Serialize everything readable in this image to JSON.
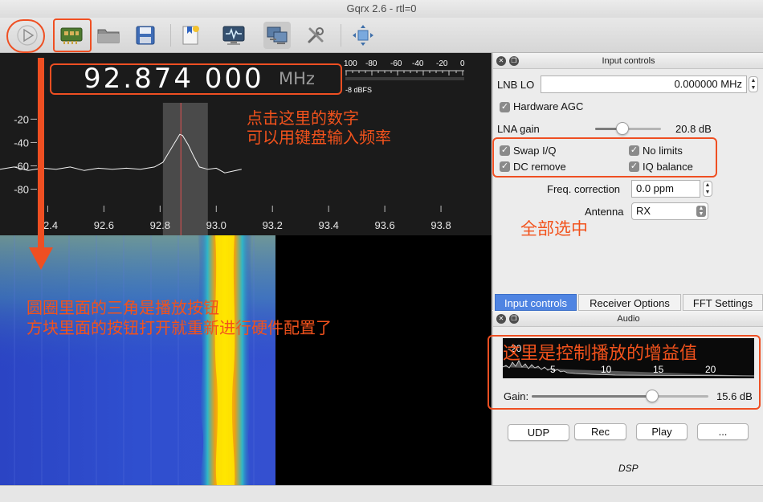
{
  "window": {
    "title": "Gqrx 2.6 - rtl=0"
  },
  "toolbar": {
    "items": [
      {
        "icon": "play-icon",
        "tip": "start-dsp"
      },
      {
        "icon": "hardware-config-icon",
        "tip": "configure-device"
      },
      {
        "icon": "folder-icon",
        "tip": "load-settings"
      },
      {
        "icon": "save-icon",
        "tip": "save-settings"
      },
      {
        "icon": "bookmark-icon",
        "tip": "bookmarks"
      },
      {
        "icon": "dsp-scope-icon",
        "tip": "iq-tool"
      },
      {
        "icon": "remote-control-icon",
        "tip": "remote-control"
      },
      {
        "icon": "tools-icon",
        "tip": "settings"
      },
      {
        "icon": "fullscreen-icon",
        "tip": "fullscreen"
      }
    ]
  },
  "frequency": {
    "digits": "92.874 000",
    "unit": "MHz"
  },
  "smeter": {
    "scale": [
      "100",
      "-80",
      "-60",
      "-40",
      "-20",
      "0"
    ],
    "unit": "-8 dBFS"
  },
  "chart_data": {
    "type": "line",
    "title": "",
    "xlabel": "",
    "ylabel": "",
    "x_ticks": [
      "92.4",
      "92.6",
      "92.8",
      "93.0",
      "93.2",
      "93.4",
      "93.6",
      "93.8"
    ],
    "y_ticks": [
      "-20",
      "-40",
      "-60",
      "-80"
    ],
    "xlim": [
      92.23,
      93.98
    ],
    "ylim": [
      -92,
      -6
    ],
    "series": [
      {
        "name": "",
        "x": [
          92.23,
          92.28,
          92.33,
          92.38,
          92.43,
          92.48,
          92.53,
          92.58,
          92.63,
          92.68,
          92.73,
          92.78,
          92.81,
          92.83,
          92.85,
          92.86,
          92.87,
          92.88,
          92.9,
          92.92,
          92.94,
          92.97,
          93.0,
          93.03,
          93.07,
          93.09
        ],
        "y": [
          -63,
          -61,
          -64,
          -62,
          -63,
          -61,
          -64,
          -62,
          -63,
          -62,
          -63,
          -61,
          -57,
          -49,
          -41,
          -37,
          -33,
          -34,
          -42,
          -52,
          -61,
          -63,
          -62,
          -66,
          -64,
          -63
        ]
      }
    ],
    "grid": false
  },
  "spectrum": {
    "filter_band": [
      92.81,
      92.97
    ],
    "center_mhz": 92.874
  },
  "input_controls": {
    "title": "Input controls",
    "lnb_label": "LNB LO",
    "lnb_value": "0.000000 MHz",
    "hw_agc": "Hardware AGC",
    "lna_label": "LNA gain",
    "lna_value": "20.8 dB",
    "lna_level": 0.42,
    "swap_iq": "Swap I/Q",
    "no_limits": "No limits",
    "dc_remove": "DC remove",
    "iq_balance": "IQ balance",
    "freq_corr_label": "Freq. correction",
    "freq_corr_value": "0.0 ppm",
    "antenna_label": "Antenna",
    "antenna_value": "RX"
  },
  "tabs": [
    "Input controls",
    "Receiver Options",
    "FFT Settings"
  ],
  "audio": {
    "title": "Audio",
    "fft_ticks": [
      "-20",
      "5",
      "10",
      "15",
      "20"
    ],
    "gain_label": "Gain:",
    "gain_value": "15.6 dB",
    "gain_level": 0.68,
    "buttons": [
      "UDP",
      "Rec",
      "Play",
      "..."
    ],
    "dsp_label": "DSP"
  },
  "annotations": {
    "freq_hint_1": "点击这里的数字",
    "freq_hint_2": "可以用键盘输入频率",
    "checkbox_hint": "全部选中",
    "toolbar_hint_1": "圆圈里面的三角是播放按钮",
    "toolbar_hint_2": "方块里面的按钮打开就重新进行硬件配置了",
    "gain_hint": "这里是控制播放的增益值"
  },
  "colors": {
    "annotation": "#ef4f22",
    "selected_tab": "#4f84e2",
    "waterfall_base": "#2a3ec8",
    "signal_core": "#ffe600"
  }
}
